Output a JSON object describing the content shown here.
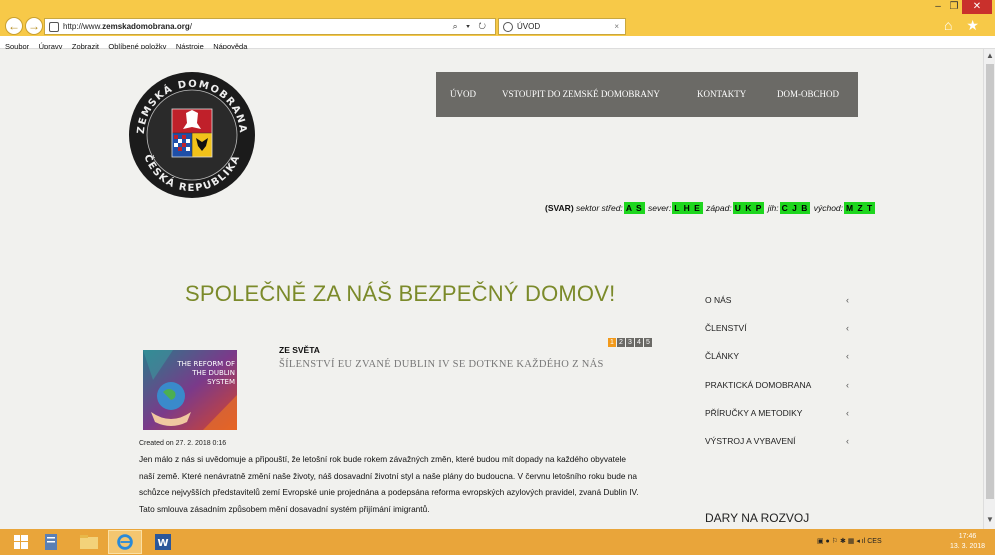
{
  "browser": {
    "url_prefix": "http://www.",
    "url_domain": "zemskadomobrana.org",
    "url_suffix": "/",
    "addr_tools": "⌕ ▾ ↻",
    "tab_title": "ÚVOD",
    "tab_close": "×",
    "win_min": "–",
    "win_max": "❐",
    "win_close": "✕",
    "right_icons": "⌂ ★ ⚙",
    "back": "←",
    "forward": "→"
  },
  "menubar": [
    "Soubor",
    "Úpravy",
    "Zobrazit",
    "Oblíbené položky",
    "Nástroje",
    "Nápověda"
  ],
  "logo": {
    "top_text": "ZEMSKÁ DOMOBRANA",
    "bottom_text": "ČESKÁ REPUBLIKA"
  },
  "nav": {
    "home": "ÚVOD",
    "join": "VSTOUPIT DO ZEMSKÉ DOMOBRANY",
    "contacts": "KONTAKTY",
    "shop": "DOM-OBCHOD"
  },
  "sectors": {
    "prefix": "(SVAR)",
    "center_label": "sektor střed:",
    "center_code": "A S",
    "north_label": "sever:",
    "north_code": "L H E",
    "west_label": "západ:",
    "west_code": "U K P",
    "south_label": "jih:",
    "south_code": "C J B",
    "east_label": "východ:",
    "east_code": "M Z T",
    "code_color": "#1ed61e"
  },
  "headline": "SPOLEČNĚ ZA NÁŠ BEZPEČNÝ DOMOV!",
  "pager": [
    "1",
    "2",
    "3",
    "4",
    "5"
  ],
  "article": {
    "category": "ZE SVĚTA",
    "title": "ŠÍLENSTVÍ EU ZVANÉ DUBLIN IV SE DOTKNE KAŽDÉHO Z NÁS",
    "image_text_1": "THE REFORM OF",
    "image_text_2": "THE DUBLIN",
    "image_text_3": "SYSTEM",
    "date": "Created on 27. 2. 2018 0:16",
    "body": "Jen málo z nás si uvědomuje a připouští, že letošní rok bude rokem závažných změn, které budou mít dopady na každého obyvatele naší země. Které nenávratně změní naše životy, náš dosavadní životní styl a naše plány do budoucna. V červnu letošního roku bude na schůzce nejvyšších představitelů zemí Evropské unie projednána a podepsána reforma evropských azylových pravidel, zvaná Dublin IV. Tato smlouva zásadním způsobem mění dosavadní systém přijímání imigrantů."
  },
  "sidebar": {
    "items": [
      "O NÁS",
      "ČLENSTVÍ",
      "ČLÁNKY",
      "PRAKTICKÁ DOMOBRANA",
      "PŘÍRUČKY A METODIKY",
      "VÝSTROJ A VYBAVENÍ"
    ],
    "arrow": "‹",
    "heading": "DARY NA ROZVOJ"
  },
  "taskbar": {
    "tray_lang": "CES",
    "time": "17:46",
    "date": "13. 3. 2018"
  },
  "colors": {
    "accent_olive": "#7b8a2a",
    "nav_bg": "#6b6a66",
    "pager_active": "#f29a1b",
    "chrome_yellow": "#f7c948",
    "taskbar": "#e9a53a"
  }
}
